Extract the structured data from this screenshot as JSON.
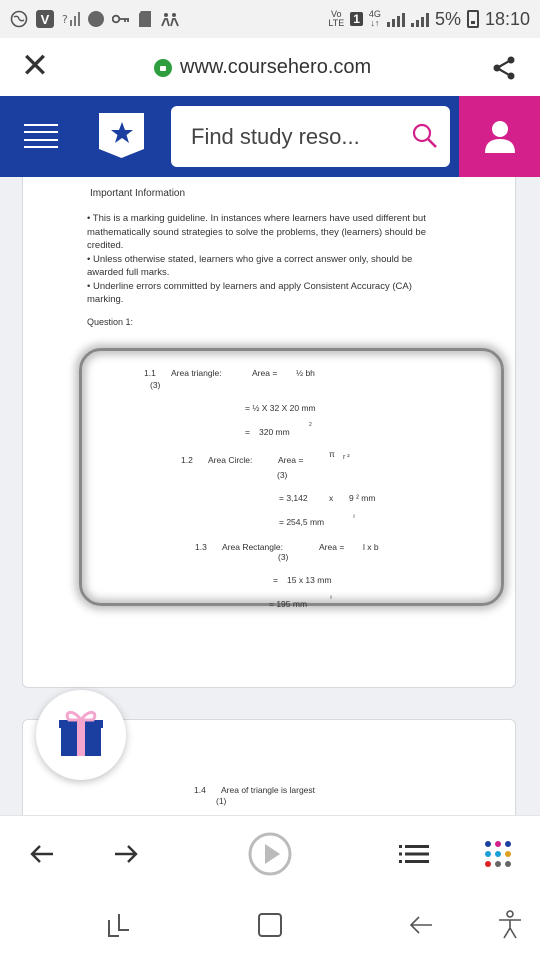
{
  "status_bar": {
    "network": "LTE",
    "network_top": "Vo",
    "sim": "1",
    "signal_type": "4G",
    "battery": "5%",
    "time": "18:10"
  },
  "browser": {
    "url": "www.coursehero.com"
  },
  "site": {
    "search_placeholder": "Find study reso...",
    "colors": {
      "header": "#1a3fa0",
      "user_button": "#d3208b"
    }
  },
  "document": {
    "heading": "Important Information",
    "bullets": [
      "• This is a marking guideline. In instances where learners have used different but mathematically sound strategies to solve the problems, they (learners) should be credited.",
      "• Unless otherwise stated, learners who give a correct answer only, should be awarded full marks.",
      "• Underline errors committed by learners and apply Consistent Accuracy (CA) marking."
    ],
    "question_label": "Question 1:",
    "answers": {
      "q1_1_num": "1.1",
      "q1_1_label": "Area triangle:",
      "q1_1_formula_a": "Area =",
      "q1_1_formula_b": "½ bh",
      "q1_1_marks": "(3)",
      "q1_1_step1": "= ½ X 32 X 20 mm",
      "q1_1_step2_eq": "=",
      "q1_1_step2": "320 mm",
      "q1_1_step2_sup": "2",
      "q1_2_num": "1.2",
      "q1_2_label": "Area Circle:",
      "q1_2_formula_a": "Area =",
      "q1_2_pi": "π",
      "q1_2_r2": "r ²",
      "q1_2_marks": "(3)",
      "q1_2_step1_a": "= 3,142",
      "q1_2_step1_x": "x",
      "q1_2_step1_b": "9 ² mm",
      "q1_2_step2": "= 254,5 mm",
      "q1_2_step2_sup": "²",
      "q1_3_num": "1.3",
      "q1_3_label": "Area Rectangle:",
      "q1_3_formula_a": "Area =",
      "q1_3_formula_b": "l x b",
      "q1_3_marks": "(3)",
      "q1_3_step1_eq": "=",
      "q1_3_step1": "15 x 13 mm",
      "q1_3_step2": "= 195 mm",
      "q1_3_step2_sup": "²",
      "q1_4_num": "1.4",
      "q1_4_label": "Area of triangle is largest",
      "q1_4_marks": "(1)"
    }
  },
  "icons": {
    "close": "close-icon",
    "share": "share-icon",
    "menu": "hamburger-icon",
    "logo": "star-shield-icon",
    "search": "search-icon",
    "user": "user-icon",
    "gift": "gift-icon",
    "back": "arrow-left-icon",
    "forward": "arrow-right-icon",
    "play": "play-icon",
    "list": "list-icon",
    "apps": "apps-dots-icon",
    "recent": "recent-apps-icon",
    "home": "home-icon",
    "nav_back": "nav-back-icon",
    "accessibility": "accessibility-icon"
  }
}
